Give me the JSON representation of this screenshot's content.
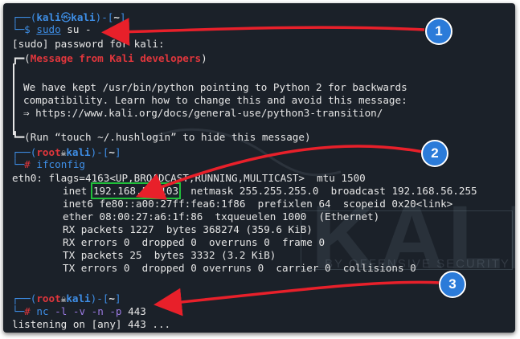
{
  "prompt": {
    "user": "kali",
    "at": "㉿",
    "host": "kali",
    "dir": "~",
    "root_user": "root",
    "hash": "#",
    "dollar": "$"
  },
  "commands": {
    "sudo_su": {
      "part1": "sudo",
      "part2": " su -"
    },
    "ifconfig": "ifconfig",
    "nc": {
      "cmd": "nc",
      "flags": " -l -v -n -p",
      "port": " 443"
    }
  },
  "output": {
    "sudo_prompt": "[sudo] password for kali:",
    "message_header": "Message from Kali developers",
    "message_lines": [
      "We have kept /usr/bin/python pointing to Python 2 for backwards",
      "compatibility. Learn how to change this and avoid this message:",
      "⇒ https://www.kali.org/docs/general-use/python3-transition/"
    ],
    "hushlogin": "Run “touch ~/.hushlogin” to hide this message",
    "ifconfig_lines": {
      "eth0": "eth0: flags=4163<UP,BROADCAST,RUNNING,MULTICAST>  mtu 1500",
      "inet_label": "inet",
      "inet_ip": "192.168.56.103",
      "inet_rest": "netmask 255.255.255.0  broadcast 192.168.56.255",
      "inet6": "inet6 fe80::a00:27ff:fea6:1f86  prefixlen 64  scopeid 0x20<link>",
      "ether": "ether 08:00:27:a6:1f:86  txqueuelen 1000  (Ethernet)",
      "rx_packets": "RX packets 1227  bytes 368274 (359.6 KiB)",
      "rx_errors": "RX errors 0  dropped 0  overruns 0  frame 0",
      "tx_packets": "TX packets 25  bytes 3332 (3.2 KiB)",
      "tx_errors": "TX errors 0  dropped 0 overruns 0  carrier 0  collisions 0"
    },
    "listening": "listening on [any] 443 ..."
  },
  "callouts": [
    "1",
    "2",
    "3"
  ],
  "watermark": {
    "logo": "KALI",
    "tagline": "BY OFFENSIVE SECURITY"
  },
  "colors": {
    "background": "#1b2129",
    "prompt_blue": "#3e8ee6",
    "red": "#e0363c",
    "highlight_green": "#20c03a",
    "arrow_red": "#e8202a",
    "callout_blue": "#2b7bd9"
  }
}
